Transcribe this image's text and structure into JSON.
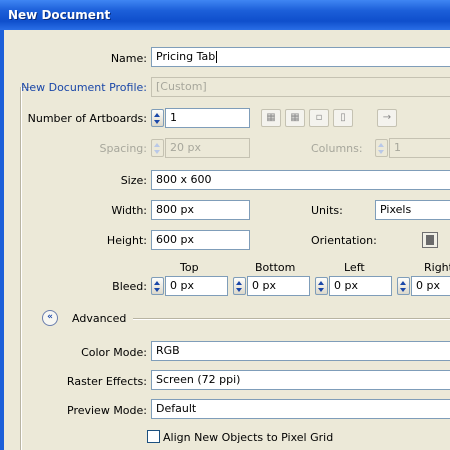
{
  "window": {
    "title": "New Document"
  },
  "name": {
    "label": "Name:",
    "value": "Pricing Tab"
  },
  "profile": {
    "label": "New Document Profile:",
    "value": "[Custom]"
  },
  "artboards": {
    "label": "Number of Artboards:",
    "value": "1",
    "arrange_arrow": "→"
  },
  "spacing": {
    "label": "Spacing:",
    "value": "20 px"
  },
  "columns": {
    "label": "Columns:",
    "value": "1"
  },
  "size": {
    "label": "Size:",
    "value": "800 x 600"
  },
  "width": {
    "label": "Width:",
    "value": "800 px"
  },
  "units": {
    "label": "Units:",
    "value": "Pixels"
  },
  "height": {
    "label": "Height:",
    "value": "600 px"
  },
  "orientation": {
    "label": "Orientation:",
    "selected": "portrait-icon"
  },
  "bleed": {
    "label": "Bleed:",
    "headers": [
      "Top",
      "Bottom",
      "Left",
      "Right"
    ],
    "values": [
      "0 px",
      "0 px",
      "0 px",
      "0 px"
    ]
  },
  "advanced": {
    "label": "Advanced",
    "toggle": "«"
  },
  "color_mode": {
    "label": "Color Mode:",
    "value": "RGB"
  },
  "raster_effects": {
    "label": "Raster Effects:",
    "value": "Screen (72 ppi)"
  },
  "preview_mode": {
    "label": "Preview Mode:",
    "value": "Default"
  },
  "align_pixel_grid": {
    "label": "Align New Objects to Pixel Grid",
    "checked": false
  },
  "colors": {
    "title_bar": "#1c5fd9",
    "dialog_bg": "#ece9d8",
    "profile_label": "#1a47a8"
  }
}
